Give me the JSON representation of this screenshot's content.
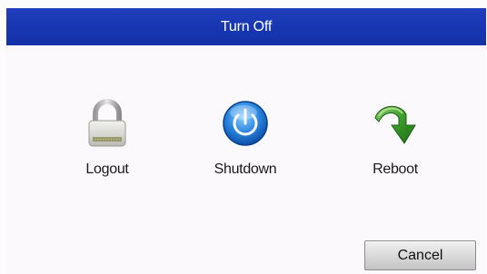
{
  "dialog": {
    "title": "Turn Off",
    "accent_color": "#1735b0",
    "options": [
      {
        "label": "Logout",
        "icon": "lock-icon"
      },
      {
        "label": "Shutdown",
        "icon": "power-icon"
      },
      {
        "label": "Reboot",
        "icon": "reboot-arrow-icon"
      }
    ],
    "cancel_label": "Cancel"
  }
}
